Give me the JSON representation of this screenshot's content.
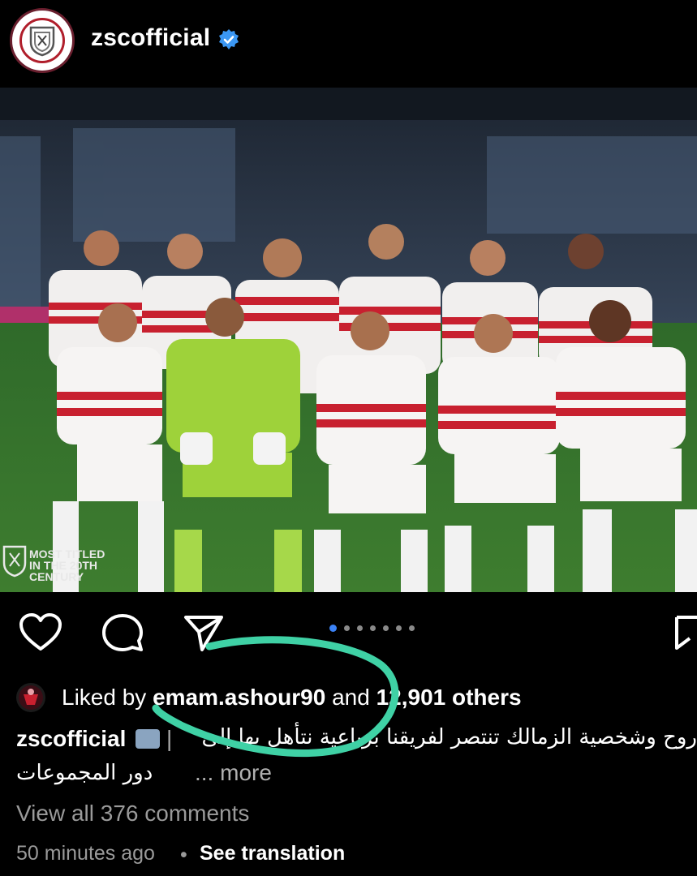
{
  "post": {
    "username": "zscofficial",
    "verified": true,
    "photo_watermark": [
      "MOST TITLED",
      "IN THE 20TH",
      "CENTURY"
    ],
    "pagination": {
      "total": 7,
      "active": 0
    }
  },
  "likes": {
    "prefix": "Liked by",
    "user": "emam.ashour90",
    "and": "and",
    "count": "12,901 others"
  },
  "caption": {
    "username": "zscofficial",
    "text_line1": "روح وشخصية الزمالك تنتصر لفريقنا برباعية نتأهل بها إلى",
    "text_line2": "دور المجموعات",
    "more": "... more"
  },
  "comments": {
    "view_all": "View all 376 comments"
  },
  "meta": {
    "time_ago": "50 minutes ago",
    "separator": "•",
    "see_translation": "See translation"
  },
  "colors": {
    "background": "#000000",
    "verified_blue": "#3b97f3",
    "highlight_scribble": "#3fd1a5",
    "jersey_red": "#c8202f",
    "keeper_green": "#9ed23a"
  }
}
